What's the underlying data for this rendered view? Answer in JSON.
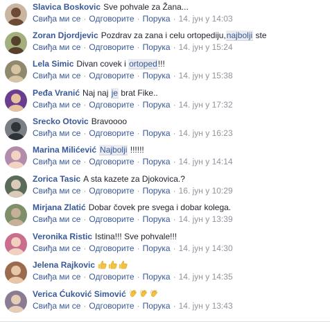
{
  "actions": {
    "like": "Свиђа ми се",
    "reply": "Одговорите",
    "message": "Порука"
  },
  "comments": [
    {
      "author": "Slavica Boskovic",
      "parts": [
        {
          "t": "Sve pohvale za Žana..."
        }
      ],
      "time": "14. јун у 14:03",
      "avatar": {
        "bg": "#c9b5a0",
        "fg": "#6d4b35"
      }
    },
    {
      "author": "Zoran Djordjevic",
      "parts": [
        {
          "t": "Pozdrav za zana i celu ortopediju,"
        },
        {
          "t": "najbolji",
          "tag": true
        },
        {
          "t": " ste"
        }
      ],
      "time": "14. јун у 15:24",
      "avatar": {
        "bg": "#a3b07e",
        "fg": "#56412e"
      }
    },
    {
      "author": "Lela Simic",
      "parts": [
        {
          "t": "Divan covek i "
        },
        {
          "t": "ortoped",
          "tag": true
        },
        {
          "t": "!!!"
        }
      ],
      "time": "14. јун у 15:38",
      "avatar": {
        "bg": "#8f8a6e",
        "fg": "#d8c3a5"
      }
    },
    {
      "author": "Peđa Vranić",
      "parts": [
        {
          "t": "Naj naj "
        },
        {
          "t": "je",
          "tag": true
        },
        {
          "t": " brat Fike.."
        }
      ],
      "time": "14. јун у 17:32",
      "avatar": {
        "bg": "#6a3d8f",
        "fg": "#e6c1a0"
      }
    },
    {
      "author": "Srecko Otovic",
      "parts": [
        {
          "t": "Bravoooo"
        }
      ],
      "time": "14. јун у 16:23",
      "avatar": {
        "bg": "#7a7f86",
        "fg": "#2e3438"
      }
    },
    {
      "author": "Marina Milićević",
      "parts": [
        {
          "t": "Najbolji",
          "tag": true
        },
        {
          "t": " !!!!!!"
        }
      ],
      "time": "14. јун у 14:14",
      "avatar": {
        "bg": "#b38cab",
        "fg": "#f2d4c2"
      }
    },
    {
      "author": "Zorica Tasic",
      "parts": [
        {
          "t": "A sta kazete za Djokovica.?"
        }
      ],
      "time": "16. јун у 10:29",
      "avatar": {
        "bg": "#5b6b5a",
        "fg": "#d9cbb8"
      }
    },
    {
      "author": "Mirjana Zlatić",
      "parts": [
        {
          "t": "Dobar čovek pre svega i dobar kolega."
        }
      ],
      "time": "14. јун у 13:39",
      "avatar": {
        "bg": "#7e8f69",
        "fg": "#c7b09a"
      }
    },
    {
      "author": "Veronika Ristic",
      "parts": [
        {
          "t": "Istina!!! Sve pohvale!!!"
        }
      ],
      "time": "14. јун у 14:30",
      "avatar": {
        "bg": "#c96e8c",
        "fg": "#f0d0bf"
      }
    },
    {
      "author": "Jelena Rajkovic",
      "parts": [],
      "emoji": [
        "thumbs-up",
        "thumbs-up",
        "thumbs-up"
      ],
      "time": "14. јун у 14:35",
      "avatar": {
        "bg": "#9b6b4f",
        "fg": "#e8c7a9"
      }
    },
    {
      "author": "Verica Ćuković Simović",
      "parts": [],
      "emoji": [
        "clapping-hands",
        "clapping-hands",
        "clapping-hands"
      ],
      "time": "14. јун у 13:43",
      "avatar": {
        "bg": "#8a7c92",
        "fg": "#e6cdb5"
      }
    }
  ],
  "colors": {
    "author": "#385898",
    "meta": "#90949c",
    "tag_bg": "#e9ebee",
    "emoji": "#f5c33b"
  }
}
